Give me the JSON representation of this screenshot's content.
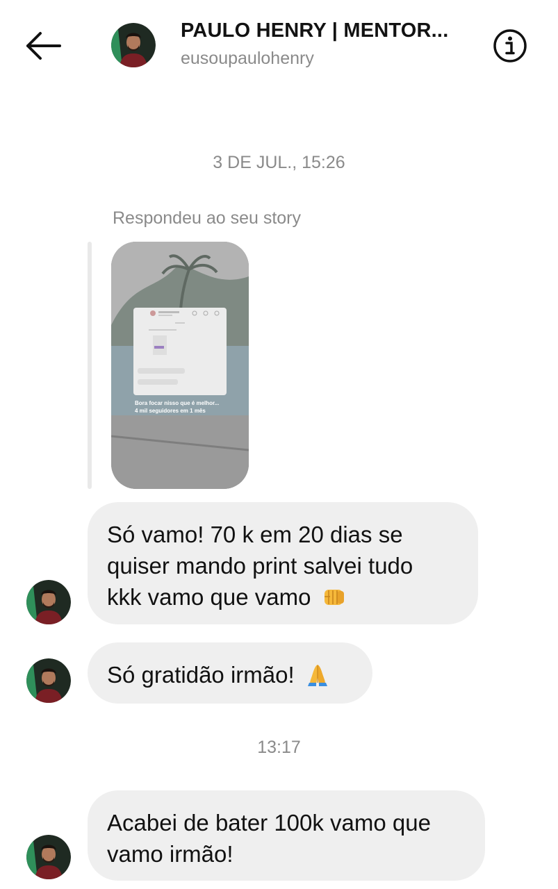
{
  "header": {
    "title": "PAULO HENRY | MENTOR...",
    "username": "eusoupaulohenry",
    "back_icon": "arrow-left-icon",
    "info_icon": "info-circle-icon"
  },
  "timestamps": [
    "3 DE JUL., 15:26",
    "13:17"
  ],
  "story_reply": {
    "label": "Respondeu ao seu story",
    "thumbnail": {
      "caption_lines": [
        "Bora focar nisso que é melhor...",
        "4 mil seguidores em 1 mês"
      ]
    }
  },
  "messages": [
    {
      "lines": [
        "Só vamo! 70 k em 20 dias se",
        "quiser mando print salvei tudo",
        "kkk vamo que vamo"
      ],
      "emoji": "oncoming-fist-icon"
    },
    {
      "lines": [
        "Só gratidão irmão!"
      ],
      "emoji": "folded-hands-icon"
    },
    {
      "lines": [
        "Acabei de bater 100k vamo que",
        "vamo irmão!"
      ],
      "emoji": ""
    }
  ],
  "colors": {
    "bubble": "#efefef",
    "secondary_text": "#8a8a8a",
    "primary_text": "#111111"
  }
}
